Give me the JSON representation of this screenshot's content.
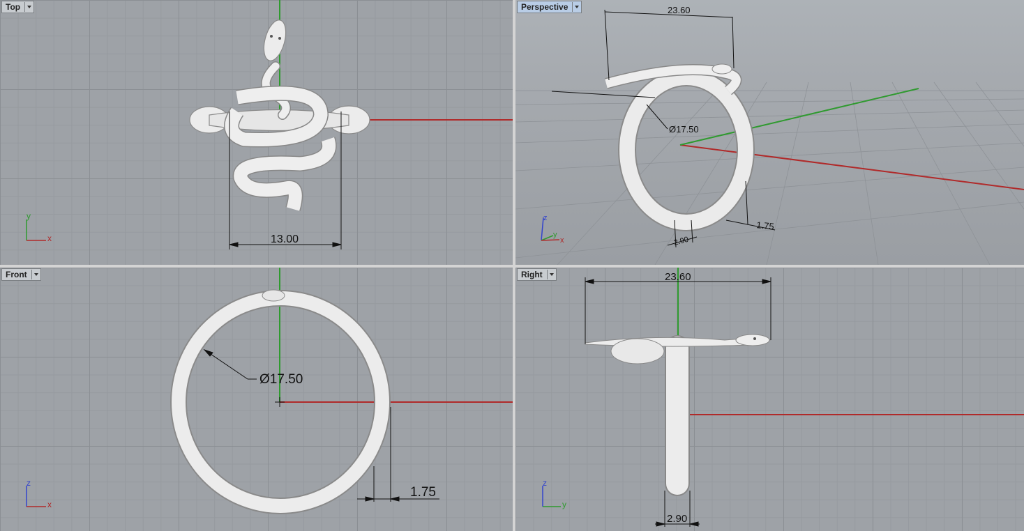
{
  "viewports": {
    "top": {
      "label": "Top",
      "dimension": "13.00",
      "axis_a": "y",
      "axis_b": "x"
    },
    "perspective": {
      "label": "Perspective",
      "dim_width": "23.60",
      "dim_diameter": "Ø17.50",
      "dim_thickness": "1.75",
      "dim_band": "2.90",
      "axis_a": "z",
      "axis_b": "y",
      "axis_c": "x"
    },
    "front": {
      "label": "Front",
      "dim_diameter": "Ø17.50",
      "dim_thickness": "1.75",
      "axis_a": "z",
      "axis_b": "x"
    },
    "right": {
      "label": "Right",
      "dim_width": "23.60",
      "dim_band": "2.90",
      "axis_a": "z",
      "axis_b": "y"
    }
  },
  "colors": {
    "x_axis": "#b02a2a",
    "y_axis": "#2f9a2f",
    "z_axis": "#3344cc",
    "model": "#e8e8e8",
    "active_tab": "#b9cde6"
  }
}
